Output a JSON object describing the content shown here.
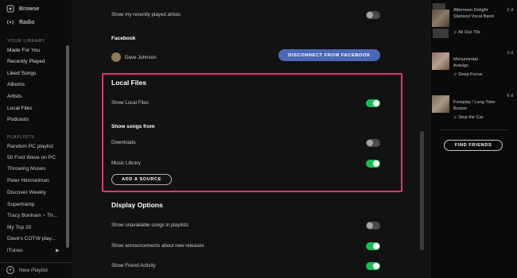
{
  "sidebar": {
    "nav": [
      {
        "label": "Browse",
        "icon": "browse-icon"
      },
      {
        "label": "Radio",
        "icon": "radio-icon"
      }
    ],
    "library_heading": "YOUR LIBRARY",
    "library": [
      "Made For You",
      "Recently Played",
      "Liked Songs",
      "Albums",
      "Artists",
      "Local Files",
      "Podcasts"
    ],
    "playlists_heading": "PLAYLISTS",
    "playlists": [
      "Random PC playlist",
      "50 Foot Wave on PC",
      "Throwing Muses",
      "Peter Himmelman",
      "Discover Weekly",
      "Supertramp",
      "Tracy Bonham ~ Th...",
      "My Top 20",
      "Dave's COTW play...",
      "iTunes"
    ],
    "new_playlist": "New Playlist"
  },
  "settings": {
    "recent_artists_label": "Show my recently played artists",
    "facebook_heading": "Facebook",
    "facebook_user": "Dave Johnson",
    "facebook_button": "DISCONNECT FROM FACEBOOK",
    "local_files_title": "Local Files",
    "show_local_files": "Show Local Files",
    "show_songs_from": "Show songs from",
    "downloads": "Downloads",
    "music_library": "Music Library",
    "add_source": "ADD A SOURCE",
    "display_options_title": "Display Options",
    "unavailable_songs": "Show unavailable songs in playlists",
    "announcements": "Show announcements about new releases",
    "friend_activity": "Show Friend Activity"
  },
  "toggles": {
    "recent_artists": "off",
    "local_files": "on",
    "downloads": "off",
    "music_library": "on",
    "unavailable_songs": "off",
    "announcements": "on",
    "friend_activity": "on"
  },
  "friends": [
    {
      "track": "Afternoon Delight",
      "artist": "Starland Vocal Band",
      "context": "All Out 70s",
      "time": "2 d"
    },
    {
      "track": "Monumental",
      "artist": "Antolgo",
      "context": "Deep Focus",
      "time": "3 d"
    },
    {
      "track": "Foreplay / Long Time",
      "artist": "Boston",
      "context": "Stop the Car",
      "time": "6 d"
    }
  ],
  "find_friends": "FIND FRIENDS",
  "colors": {
    "accent_green": "#1db954",
    "highlight_pink": "#e8336a",
    "facebook_blue": "#4a68b5"
  }
}
